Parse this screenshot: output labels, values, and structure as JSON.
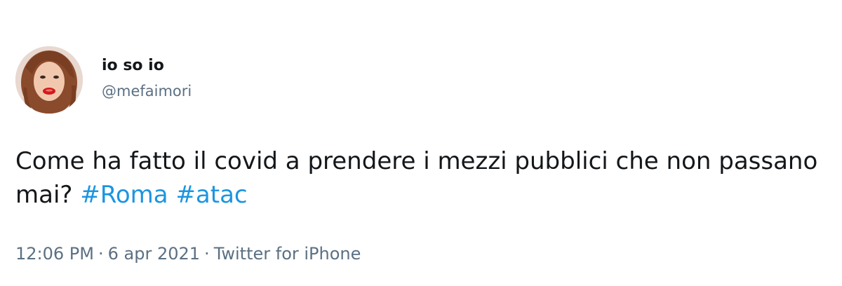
{
  "author": {
    "display_name": "io so io",
    "handle": "@mefaimori",
    "avatar_icon": "profile-photo"
  },
  "tweet": {
    "text_plain": "Come ha fatto il covid a prendere i mezzi pubblici che non passano mai?",
    "hashtags": [
      "#Roma",
      "#atac"
    ],
    "hashtag_color": "#1b95e0"
  },
  "meta": {
    "time": "12:06 PM",
    "date": "6 apr 2021",
    "separator": "·",
    "source": "Twitter for iPhone"
  },
  "colors": {
    "text": "#14171a",
    "secondary": "#5b7083",
    "accent": "#1b95e0",
    "background": "#ffffff"
  }
}
